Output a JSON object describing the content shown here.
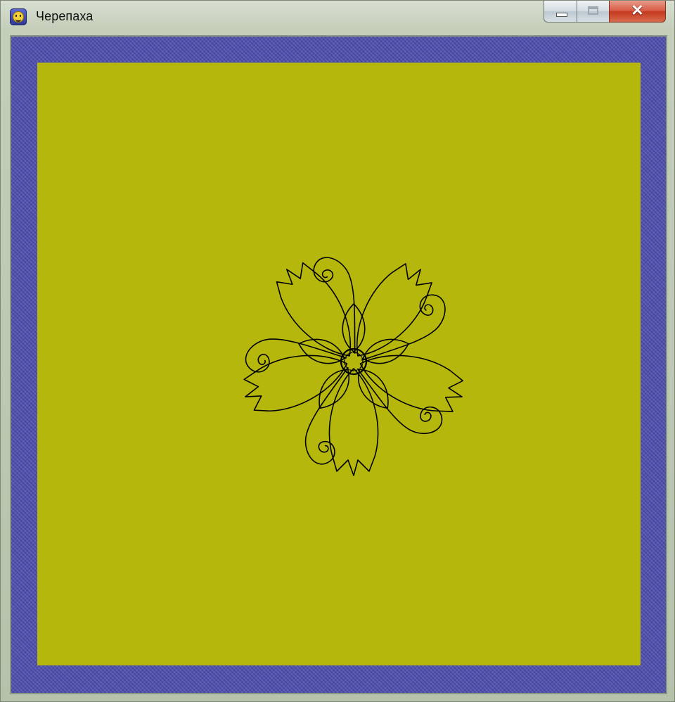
{
  "window": {
    "title": "Черепаха",
    "icon": "smiley-turtle-icon",
    "controls": {
      "minimize": "minimize-icon",
      "maximize": "maximize-icon",
      "close": "close-icon"
    },
    "close_glyph": "✕"
  },
  "colors": {
    "canvas_background": "#b6b70d",
    "border_pattern": "#4f4fb0",
    "ink": "#000000"
  },
  "drawing": {
    "subject": "flower-drawing",
    "petals": 5,
    "tendrils": 5
  }
}
